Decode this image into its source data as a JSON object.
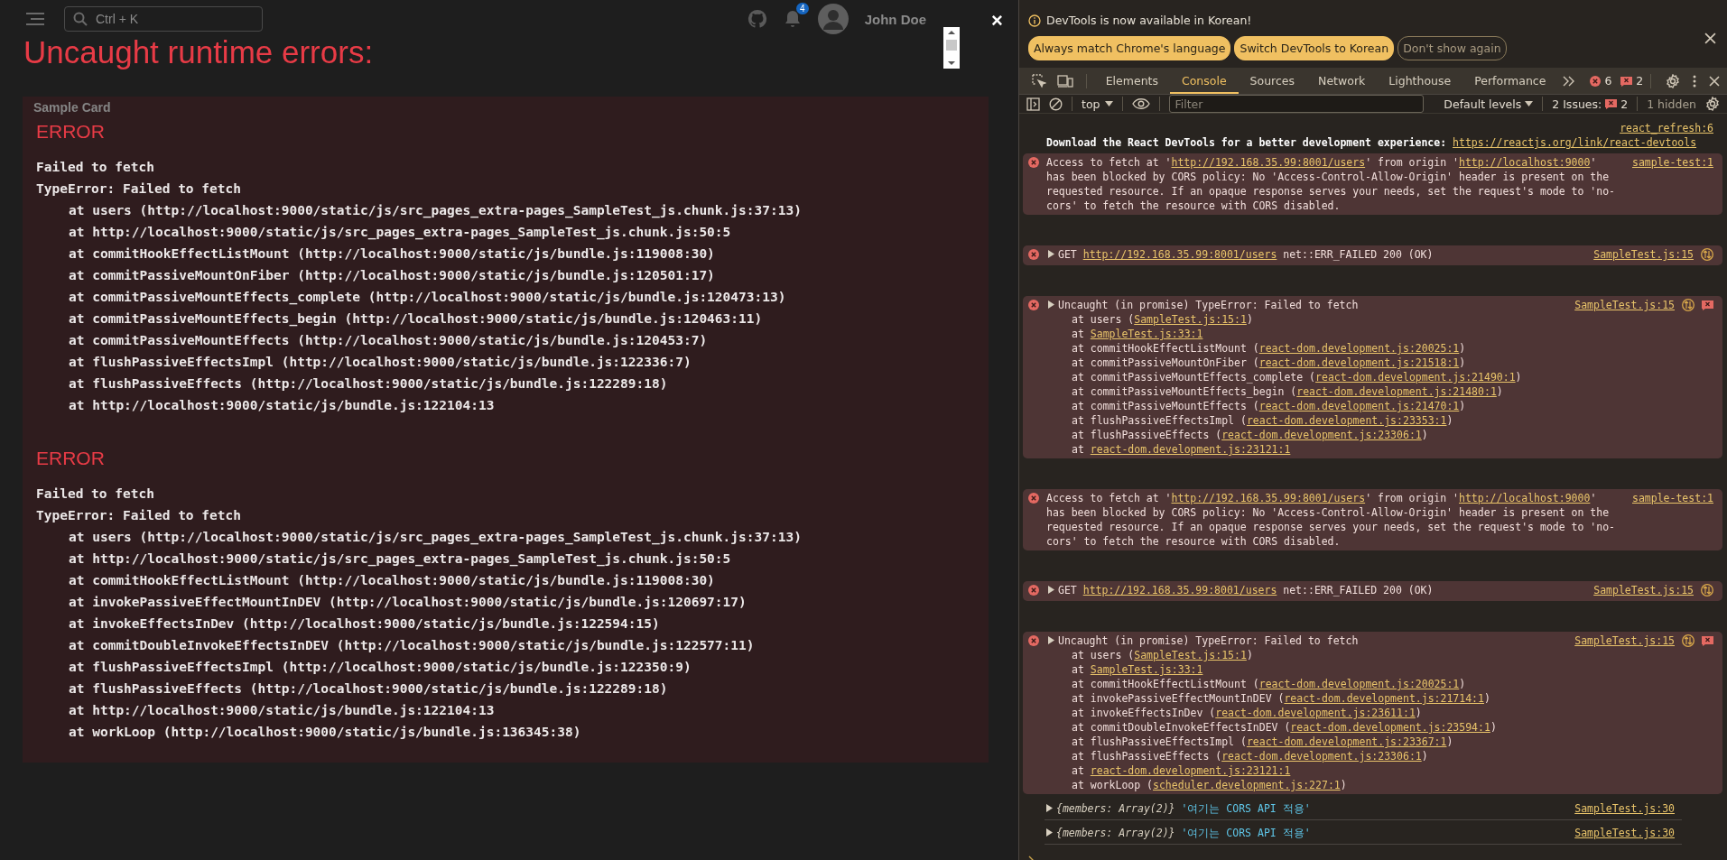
{
  "page": {
    "search": {
      "placeholder": "Ctrl + K"
    },
    "notification_count": "4",
    "user_name": "John Doe",
    "card_title": "Sample Card"
  },
  "error_overlay": {
    "title": "Uncaught runtime errors:",
    "close": "×",
    "errors": [
      {
        "label": "ERROR",
        "message": "Failed to fetch",
        "error_type": "TypeError: Failed to fetch",
        "frames": [
          "at users (http://localhost:9000/static/js/src_pages_extra-pages_SampleTest_js.chunk.js:37:13)",
          "at http://localhost:9000/static/js/src_pages_extra-pages_SampleTest_js.chunk.js:50:5",
          "at commitHookEffectListMount (http://localhost:9000/static/js/bundle.js:119008:30)",
          "at commitPassiveMountOnFiber (http://localhost:9000/static/js/bundle.js:120501:17)",
          "at commitPassiveMountEffects_complete (http://localhost:9000/static/js/bundle.js:120473:13)",
          "at commitPassiveMountEffects_begin (http://localhost:9000/static/js/bundle.js:120463:11)",
          "at commitPassiveMountEffects (http://localhost:9000/static/js/bundle.js:120453:7)",
          "at flushPassiveEffectsImpl (http://localhost:9000/static/js/bundle.js:122336:7)",
          "at flushPassiveEffects (http://localhost:9000/static/js/bundle.js:122289:18)",
          "at http://localhost:9000/static/js/bundle.js:122104:13"
        ]
      },
      {
        "label": "ERROR",
        "message": "Failed to fetch",
        "error_type": "TypeError: Failed to fetch",
        "frames": [
          "at users (http://localhost:9000/static/js/src_pages_extra-pages_SampleTest_js.chunk.js:37:13)",
          "at http://localhost:9000/static/js/src_pages_extra-pages_SampleTest_js.chunk.js:50:5",
          "at commitHookEffectListMount (http://localhost:9000/static/js/bundle.js:119008:30)",
          "at invokePassiveEffectMountInDEV (http://localhost:9000/static/js/bundle.js:120697:17)",
          "at invokeEffectsInDev (http://localhost:9000/static/js/bundle.js:122594:15)",
          "at commitDoubleInvokeEffectsInDEV (http://localhost:9000/static/js/bundle.js:122577:11)",
          "at flushPassiveEffectsImpl (http://localhost:9000/static/js/bundle.js:122350:9)",
          "at flushPassiveEffects (http://localhost:9000/static/js/bundle.js:122289:18)",
          "at http://localhost:9000/static/js/bundle.js:122104:13",
          "at workLoop (http://localhost:9000/static/js/bundle.js:136345:38)"
        ]
      }
    ]
  },
  "devtools": {
    "infobar": {
      "message": "DevTools is now available in Korean!",
      "buttons": [
        {
          "label": "Always match Chrome's language",
          "kind": "filled"
        },
        {
          "label": "Switch DevTools to Korean",
          "kind": "filled"
        },
        {
          "label": "Don't show again",
          "kind": "outline"
        }
      ]
    },
    "tabs": [
      {
        "label": "Elements",
        "selected": false
      },
      {
        "label": "Console",
        "selected": true
      },
      {
        "label": "Sources",
        "selected": false
      },
      {
        "label": "Network",
        "selected": false
      },
      {
        "label": "Lighthouse",
        "selected": false
      },
      {
        "label": "Performance",
        "selected": false
      }
    ],
    "error_count": "6",
    "issue_count": "2",
    "console_toolbar": {
      "context": "top",
      "filter": {
        "placeholder": "Filter"
      },
      "levels": "Default levels",
      "issues_label": "2 Issues:",
      "issues_count": "2",
      "hidden": "1 hidden"
    },
    "messages": [
      {
        "kind": "info",
        "source": "react_refresh:6",
        "parts": [
          {
            "kind": "text",
            "text": "Download the React DevTools for a better development experience: "
          },
          {
            "kind": "link",
            "text": "https://reactjs.org/link/"
          },
          {
            "kind": "link",
            "text": "react-devtools"
          }
        ]
      },
      {
        "kind": "cors",
        "source": "sample-test:1",
        "parts": [
          {
            "kind": "text",
            "text": "Access to fetch at '"
          },
          {
            "kind": "link",
            "text": "http://192.168.35.99:8001/users"
          },
          {
            "kind": "text",
            "text": "' from origin '"
          },
          {
            "kind": "link",
            "text": "http://localhost:9000"
          },
          {
            "kind": "text",
            "text": "' has been blocked by CORS policy: No 'Access-Control-Allow-Origin' header is present on the requested resource. If an opaque response serves your needs, set the request's mode to 'no-cors' to fetch the resource with CORS disabled."
          }
        ]
      },
      {
        "kind": "network",
        "expandable": true,
        "source": "SampleTest.js:15",
        "parts": [
          {
            "kind": "text",
            "text": "GET "
          },
          {
            "kind": "link",
            "text": "http://192.168.35.99:8001/users"
          },
          {
            "kind": "text",
            "text": " net::ERR_FAILED 200 (OK)"
          }
        ]
      },
      {
        "kind": "exception",
        "expandable": true,
        "source": "SampleTest.js:15",
        "parts": [
          {
            "kind": "text",
            "text": "Uncaught (in promise) TypeError: Failed to fetch"
          }
        ],
        "frames": [
          {
            "before": "at users (",
            "link": "SampleTest.js:15:1",
            "after": ")"
          },
          {
            "before": "at ",
            "link": "SampleTest.js:33:1"
          },
          {
            "before": "at commitHookEffectListMount (",
            "link": "react-dom.development.js:20025:1",
            "after": ")"
          },
          {
            "before": "at commitPassiveMountOnFiber (",
            "link": "react-dom.development.js:21518:1",
            "after": ")"
          },
          {
            "before": "at commitPassiveMountEffects_complete (",
            "link": "react-dom.development.js:21490:1",
            "after": ")"
          },
          {
            "before": "at commitPassiveMountEffects_begin (",
            "link": "react-dom.development.js:21480:1",
            "after": ")"
          },
          {
            "before": "at commitPassiveMountEffects (",
            "link": "react-dom.development.js:21470:1",
            "after": ")"
          },
          {
            "before": "at flushPassiveEffectsImpl (",
            "link": "react-dom.development.js:23353:1",
            "after": ")"
          },
          {
            "before": "at flushPassiveEffects (",
            "link": "react-dom.development.js:23306:1",
            "after": ")"
          },
          {
            "before": "at ",
            "link": "react-dom.development.js:23121:1"
          }
        ]
      },
      {
        "kind": "cors",
        "source": "sample-test:1",
        "parts": [
          {
            "kind": "text",
            "text": "Access to fetch at '"
          },
          {
            "kind": "link",
            "text": "http://192.168.35.99:8001/users"
          },
          {
            "kind": "text",
            "text": "' from origin '"
          },
          {
            "kind": "link",
            "text": "http://localhost:9000"
          },
          {
            "kind": "text",
            "text": "' has been blocked by CORS policy: No 'Access-Control-Allow-Origin' header is present on the requested resource. If an opaque response serves your needs, set the request's mode to 'no-cors' to fetch the resource with CORS disabled."
          }
        ]
      },
      {
        "kind": "network",
        "expandable": true,
        "source": "SampleTest.js:15",
        "parts": [
          {
            "kind": "text",
            "text": "GET "
          },
          {
            "kind": "link",
            "text": "http://192.168.35.99:8001/users"
          },
          {
            "kind": "text",
            "text": " net::ERR_FAILED 200 (OK)"
          }
        ]
      },
      {
        "kind": "exception",
        "expandable": true,
        "source": "SampleTest.js:15",
        "parts": [
          {
            "kind": "text",
            "text": "Uncaught (in promise) TypeError: Failed to fetch"
          }
        ],
        "frames": [
          {
            "before": "at users (",
            "link": "SampleTest.js:15:1",
            "after": ")"
          },
          {
            "before": "at ",
            "link": "SampleTest.js:33:1"
          },
          {
            "before": "at commitHookEffectListMount (",
            "link": "react-dom.development.js:20025:1",
            "after": ")"
          },
          {
            "before": "at invokePassiveEffectMountInDEV (",
            "link": "react-dom.development.js:21714:1",
            "after": ")"
          },
          {
            "before": "at invokeEffectsInDev (",
            "link": "react-dom.development.js:23611:1",
            "after": ")"
          },
          {
            "before": "at commitDoubleInvokeEffectsInDEV (",
            "link": "react-dom.development.js:23594:1",
            "after": ")"
          },
          {
            "before": "at flushPassiveEffectsImpl (",
            "link": "react-dom.development.js:23367:1",
            "after": ")"
          },
          {
            "before": "at flushPassiveEffects (",
            "link": "react-dom.development.js:23306:1",
            "after": ")"
          },
          {
            "before": "at ",
            "link": "react-dom.development.js:23121:1"
          },
          {
            "before": "at workLoop (",
            "link": "scheduler.development.js:227:1",
            "after": ")"
          }
        ]
      },
      {
        "kind": "log",
        "expandable": true,
        "source": "SampleTest.js:30",
        "preview": "{members: Array(2)}",
        "string": "'여기는 CORS API 적용'"
      },
      {
        "kind": "log",
        "expandable": true,
        "source": "SampleTest.js:30",
        "preview": "{members: Array(2)}",
        "string": "'여기는 CORS API 적용'"
      }
    ]
  }
}
